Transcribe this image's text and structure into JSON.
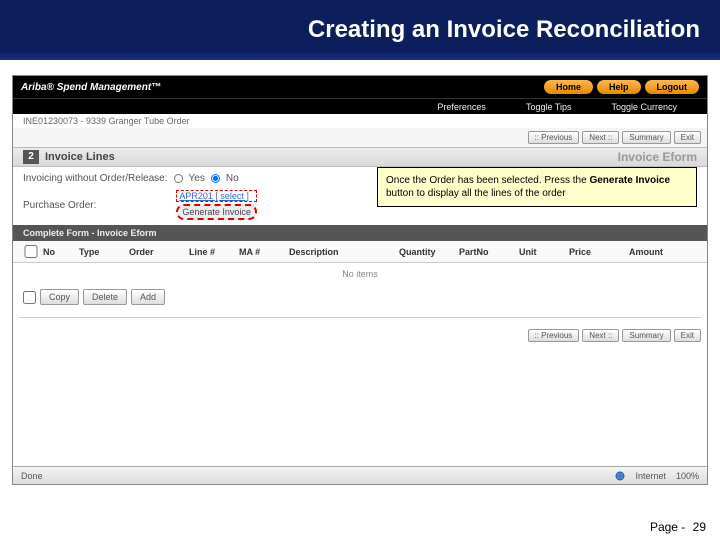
{
  "slide": {
    "title": "Creating an Invoice Reconciliation",
    "page_label": "Page -",
    "page_number": "29"
  },
  "app": {
    "brand": "Ariba® Spend Management™",
    "nav": {
      "home": "Home",
      "help": "Help",
      "logout": "Logout"
    },
    "subnav": {
      "preferences": "Preferences",
      "toggle_tips": "Toggle Tips",
      "toggle_currency": "Toggle Currency"
    },
    "breadcrumb": "INE01230073 - 9339 Granger Tube Order"
  },
  "toolbar": {
    "previous": ":: Previous",
    "next": "Next ::",
    "summary": "Summary",
    "exit": "Exit"
  },
  "section": {
    "step": "2",
    "title": "Invoice Lines",
    "eform": "Invoice Eform"
  },
  "form": {
    "q1_label": "Invoicing without Order/Release:",
    "yes": "Yes",
    "no": "No",
    "po_label": "Purchase Order:",
    "select_link": "APR201 [ select ]",
    "generate_btn": "Generate Invoice"
  },
  "callout": {
    "part1": "Once the Order has been selected.  Press the ",
    "bold": "Generate Invoice",
    "part2": " button to display all the lines of the order"
  },
  "lines": {
    "header": "Complete Form - Invoice Eform",
    "columns": {
      "chk": "",
      "no": "No",
      "type": "Type",
      "order": "Order",
      "line": "Line #",
      "ma": "MA #",
      "description": "Description",
      "quantity": "Quantity",
      "partno": "PartNo",
      "unit": "Unit",
      "price": "Price",
      "amount": "Amount"
    },
    "no_items": "No items",
    "copy": "Copy",
    "delete": "Delete",
    "add": "Add"
  },
  "statusbar": {
    "done": "Done",
    "internet": "Internet",
    "zoom": "100%"
  }
}
